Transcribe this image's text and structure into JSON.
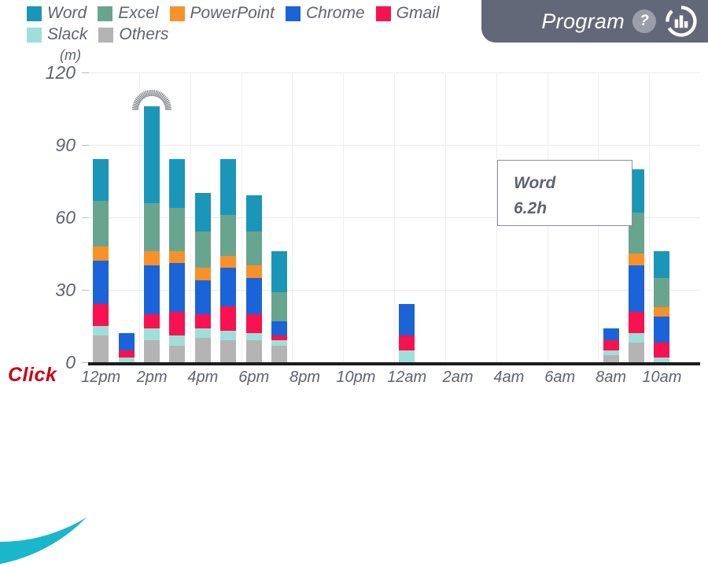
{
  "header": {
    "title": "Program",
    "help_label": "?",
    "badge_icon": "bar-chart-circle-icon"
  },
  "overlay": {
    "click_label": "Click"
  },
  "legend": {
    "items": [
      {
        "label": "Word",
        "color": "#1a96b8"
      },
      {
        "label": "Excel",
        "color": "#68a58e"
      },
      {
        "label": "PowerPoint",
        "color": "#f89128"
      },
      {
        "label": "Chrome",
        "color": "#1b63d8"
      },
      {
        "label": "Gmail",
        "color": "#f8124f"
      },
      {
        "label": "Slack",
        "color": "#9fdfd9"
      },
      {
        "label": "Others",
        "color": "#b4b4b4"
      }
    ]
  },
  "callout": {
    "title": "Word",
    "value": "6.2h"
  },
  "chart_data": {
    "type": "bar",
    "stacked": true,
    "title": "",
    "xlabel": "",
    "ylabel": "(m)",
    "ylim": [
      0,
      120
    ],
    "yticks": [
      0,
      30,
      60,
      90,
      120
    ],
    "grid": true,
    "legend_position": "top-left",
    "categories": [
      "12pm",
      "1pm",
      "2pm",
      "3pm",
      "4pm",
      "5pm",
      "6pm",
      "7pm",
      "8pm",
      "9pm",
      "10pm",
      "11pm",
      "12am",
      "1am",
      "2am",
      "3am",
      "4am",
      "5am",
      "6am",
      "7am",
      "8am",
      "9am",
      "10am",
      "11am"
    ],
    "tick_labels": [
      "12pm",
      "2pm",
      "4pm",
      "6pm",
      "8pm",
      "10pm",
      "12am",
      "2am",
      "4am",
      "6am",
      "8am",
      "10am"
    ],
    "series": [
      {
        "name": "Others",
        "color": "#b4b4b4",
        "values": [
          11,
          0,
          9,
          7,
          10,
          9,
          9,
          7,
          0,
          0,
          0,
          0,
          0,
          0,
          0,
          0,
          0,
          0,
          0,
          0,
          3,
          8,
          0,
          0
        ]
      },
      {
        "name": "Slack",
        "color": "#9fdfd9",
        "values": [
          4,
          2,
          5,
          4,
          4,
          4,
          3,
          2,
          0,
          0,
          0,
          0,
          5,
          0,
          0,
          0,
          0,
          0,
          0,
          0,
          2,
          4,
          2,
          0
        ]
      },
      {
        "name": "Gmail",
        "color": "#f8124f",
        "values": [
          9,
          3,
          6,
          10,
          6,
          10,
          8,
          2,
          0,
          0,
          0,
          0,
          6,
          0,
          0,
          0,
          0,
          0,
          0,
          0,
          4,
          9,
          6,
          0
        ]
      },
      {
        "name": "Chrome",
        "color": "#1b63d8",
        "values": [
          18,
          7,
          20,
          20,
          14,
          16,
          15,
          6,
          0,
          0,
          0,
          0,
          13,
          0,
          0,
          0,
          0,
          0,
          0,
          0,
          5,
          19,
          11,
          0
        ]
      },
      {
        "name": "PowerPoint",
        "color": "#f89128",
        "values": [
          6,
          0,
          6,
          5,
          5,
          5,
          5,
          0,
          0,
          0,
          0,
          0,
          0,
          0,
          0,
          0,
          0,
          0,
          0,
          0,
          0,
          5,
          4,
          0
        ]
      },
      {
        "name": "Excel",
        "color": "#68a58e",
        "values": [
          19,
          0,
          20,
          18,
          15,
          17,
          14,
          12,
          0,
          0,
          0,
          0,
          0,
          0,
          0,
          0,
          0,
          0,
          0,
          0,
          0,
          17,
          12,
          0
        ]
      },
      {
        "name": "Word",
        "color": "#1a96b8",
        "values": [
          17,
          0,
          40,
          20,
          16,
          23,
          15,
          17,
          0,
          0,
          0,
          0,
          0,
          0,
          0,
          0,
          0,
          0,
          0,
          0,
          0,
          18,
          11,
          0
        ]
      }
    ],
    "totals": [
      84,
      12,
      106,
      84,
      70,
      84,
      69,
      46,
      0,
      0,
      0,
      0,
      24,
      0,
      0,
      0,
      0,
      0,
      0,
      0,
      14,
      80,
      46,
      0
    ],
    "highlighted_index": 2,
    "highlight_effect": "radial-burst"
  }
}
